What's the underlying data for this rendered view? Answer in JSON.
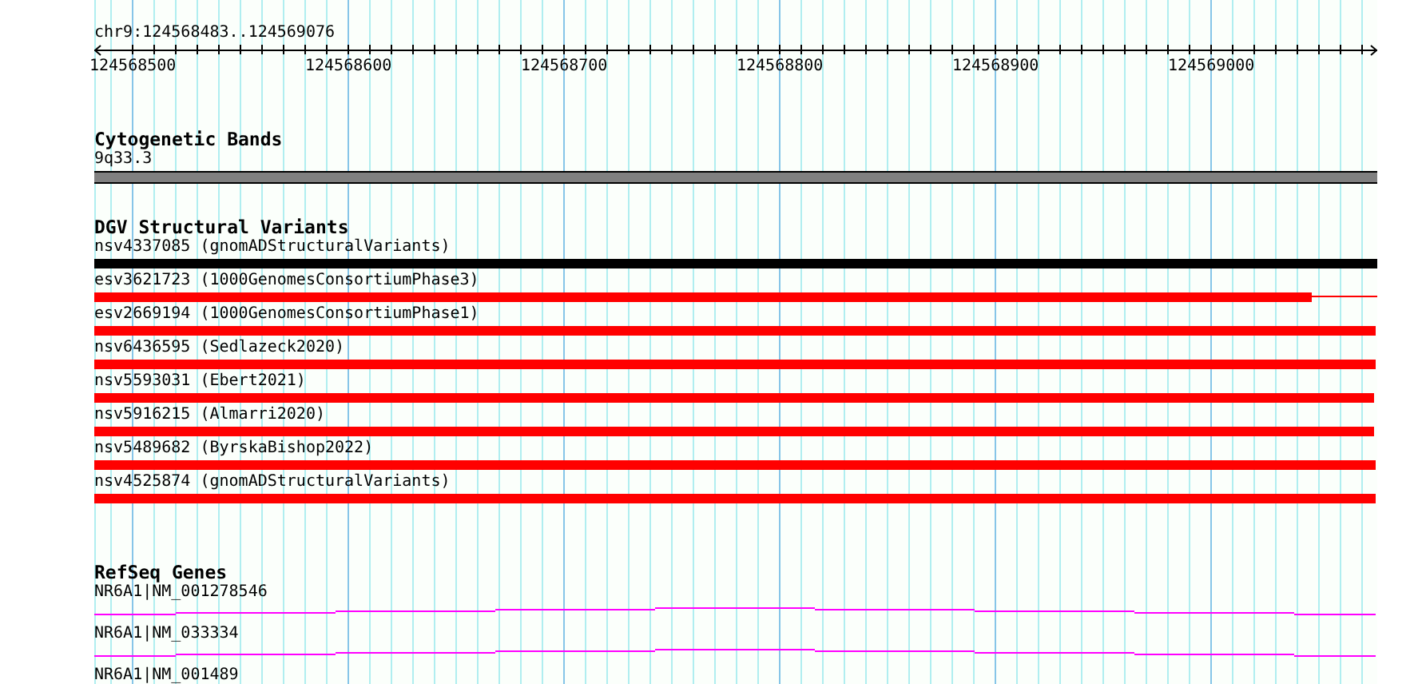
{
  "location": "chr9:124568483..124569076",
  "ruler": {
    "ticks": [
      "124568500",
      "124568600",
      "124568700",
      "124568800",
      "124568900",
      "124569000"
    ]
  },
  "tracks": [
    {
      "kind": "cytoband",
      "title": "Cytogenetic Bands",
      "band": "9q33.3"
    },
    {
      "kind": "variants",
      "title": "DGV Structural Variants",
      "items": [
        {
          "label": "nsv4337085 (gnomADStructuralVariants)",
          "color": "#000000"
        },
        {
          "label": "esv3621723 (1000GenomesConsortiumPhase3)",
          "color": "#ff0000"
        },
        {
          "label": "esv2669194 (1000GenomesConsortiumPhase1)",
          "color": "#ff0000"
        },
        {
          "label": "nsv6436595 (Sedlazeck2020)",
          "color": "#ff0000"
        },
        {
          "label": "nsv5593031 (Ebert2021)",
          "color": "#ff0000"
        },
        {
          "label": "nsv5916215 (Almarri2020)",
          "color": "#ff0000"
        },
        {
          "label": "nsv5489682 (ByrskaBishop2022)",
          "color": "#ff0000"
        },
        {
          "label": "nsv4525874 (gnomADStructuralVariants)",
          "color": "#ff0000"
        }
      ]
    },
    {
      "kind": "genes",
      "title": "RefSeq Genes",
      "items": [
        {
          "label": "NR6A1|NM_001278546"
        },
        {
          "label": "NR6A1|NM_033334"
        },
        {
          "label": "NR6A1|NM_001489"
        }
      ]
    }
  ]
}
